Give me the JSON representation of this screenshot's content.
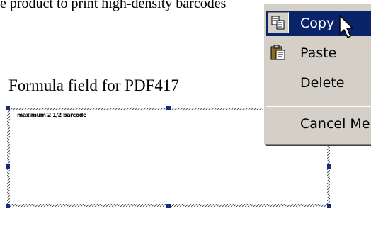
{
  "top_text": "e product to print high-density barcodes",
  "field": {
    "label": "Formula field for PDF417",
    "barcode_hint": "maximum 2 1/2 barcode"
  },
  "context_menu": {
    "items": [
      {
        "label": "Copy",
        "icon": "copy-icon",
        "active": true
      },
      {
        "label": "Paste",
        "icon": "paste-icon",
        "active": false
      },
      {
        "label": "Delete",
        "icon": "",
        "active": false
      },
      {
        "label": "Cancel Menu",
        "icon": "",
        "active": false
      }
    ]
  },
  "colors": {
    "menu_bg": "#d4d0c8",
    "highlight": "#0a246a",
    "handle": "#1a2a7a"
  }
}
